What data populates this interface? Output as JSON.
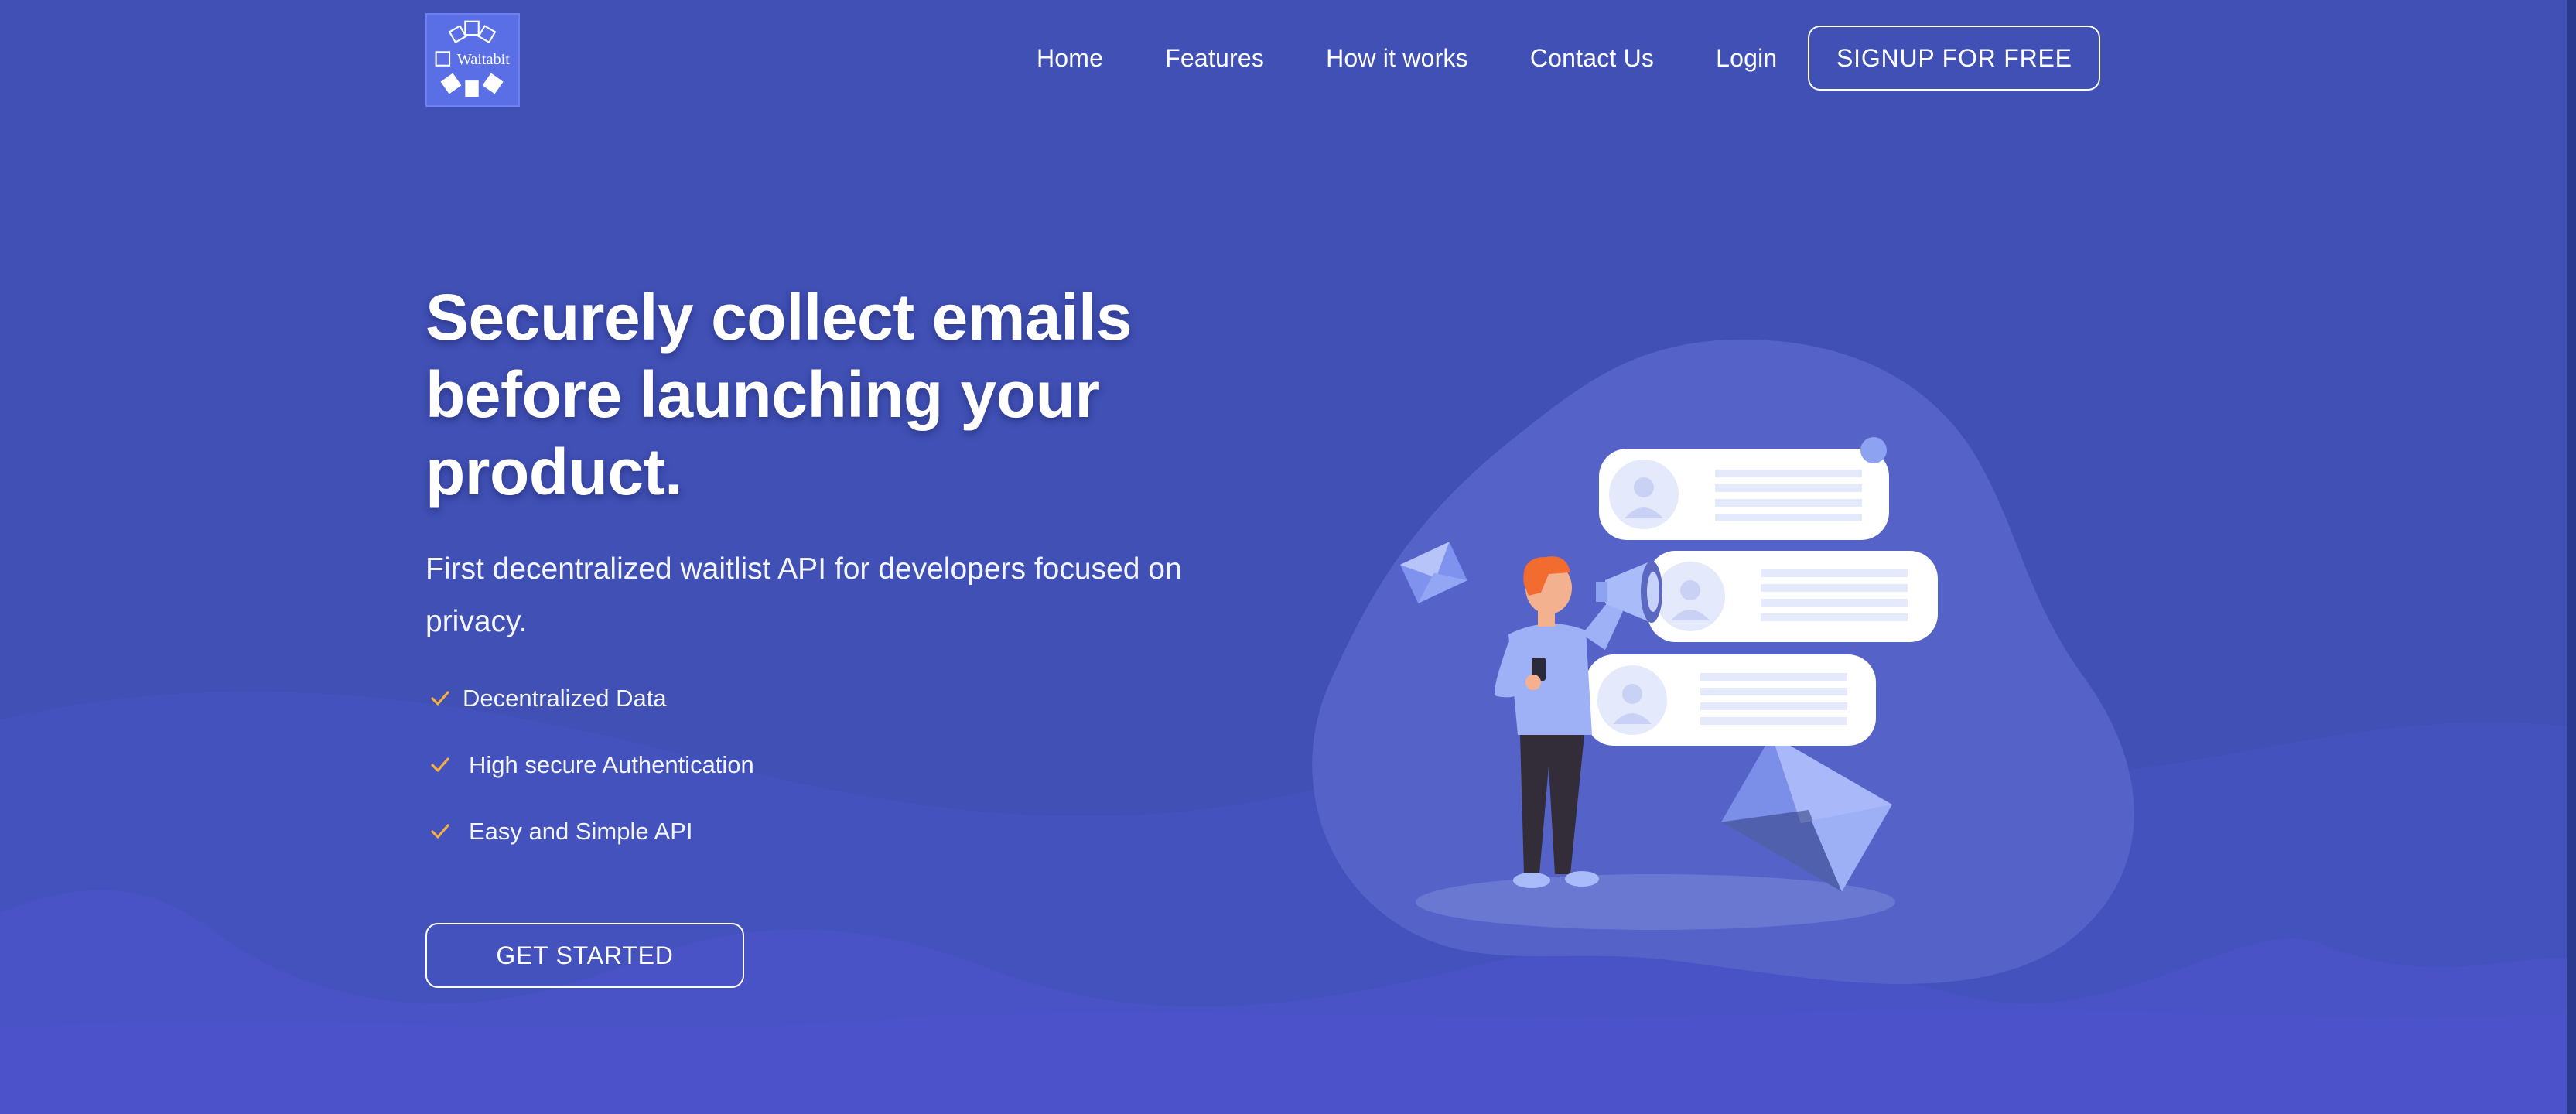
{
  "logo": {
    "text": "Waitabit"
  },
  "nav": {
    "items": [
      {
        "label": "Home"
      },
      {
        "label": "Features"
      },
      {
        "label": "How it works"
      },
      {
        "label": "Contact Us"
      },
      {
        "label": "Login"
      }
    ],
    "signup_label": "SIGNUP FOR FREE"
  },
  "hero": {
    "title": "Securely collect emails before launching your product.",
    "subtitle": "First decentralized waitlist API for developers focused on privacy.",
    "features": [
      {
        "label": "Decentralized Data",
        "icon": "check-icon"
      },
      {
        "label": "High secure Authentication",
        "icon": "check-icon"
      },
      {
        "label": "Easy and Simple API",
        "icon": "check-icon"
      }
    ],
    "cta_label": "GET STARTED"
  },
  "colors": {
    "background": "#4050b5",
    "wave_light": "#4652c0",
    "wave_bottom": "#4b52c8",
    "check": "#f5b041",
    "blob": "#5563c8",
    "card": "#ffffff",
    "person_hair": "#f26b2f",
    "accent_light": "#8ea2f2"
  }
}
